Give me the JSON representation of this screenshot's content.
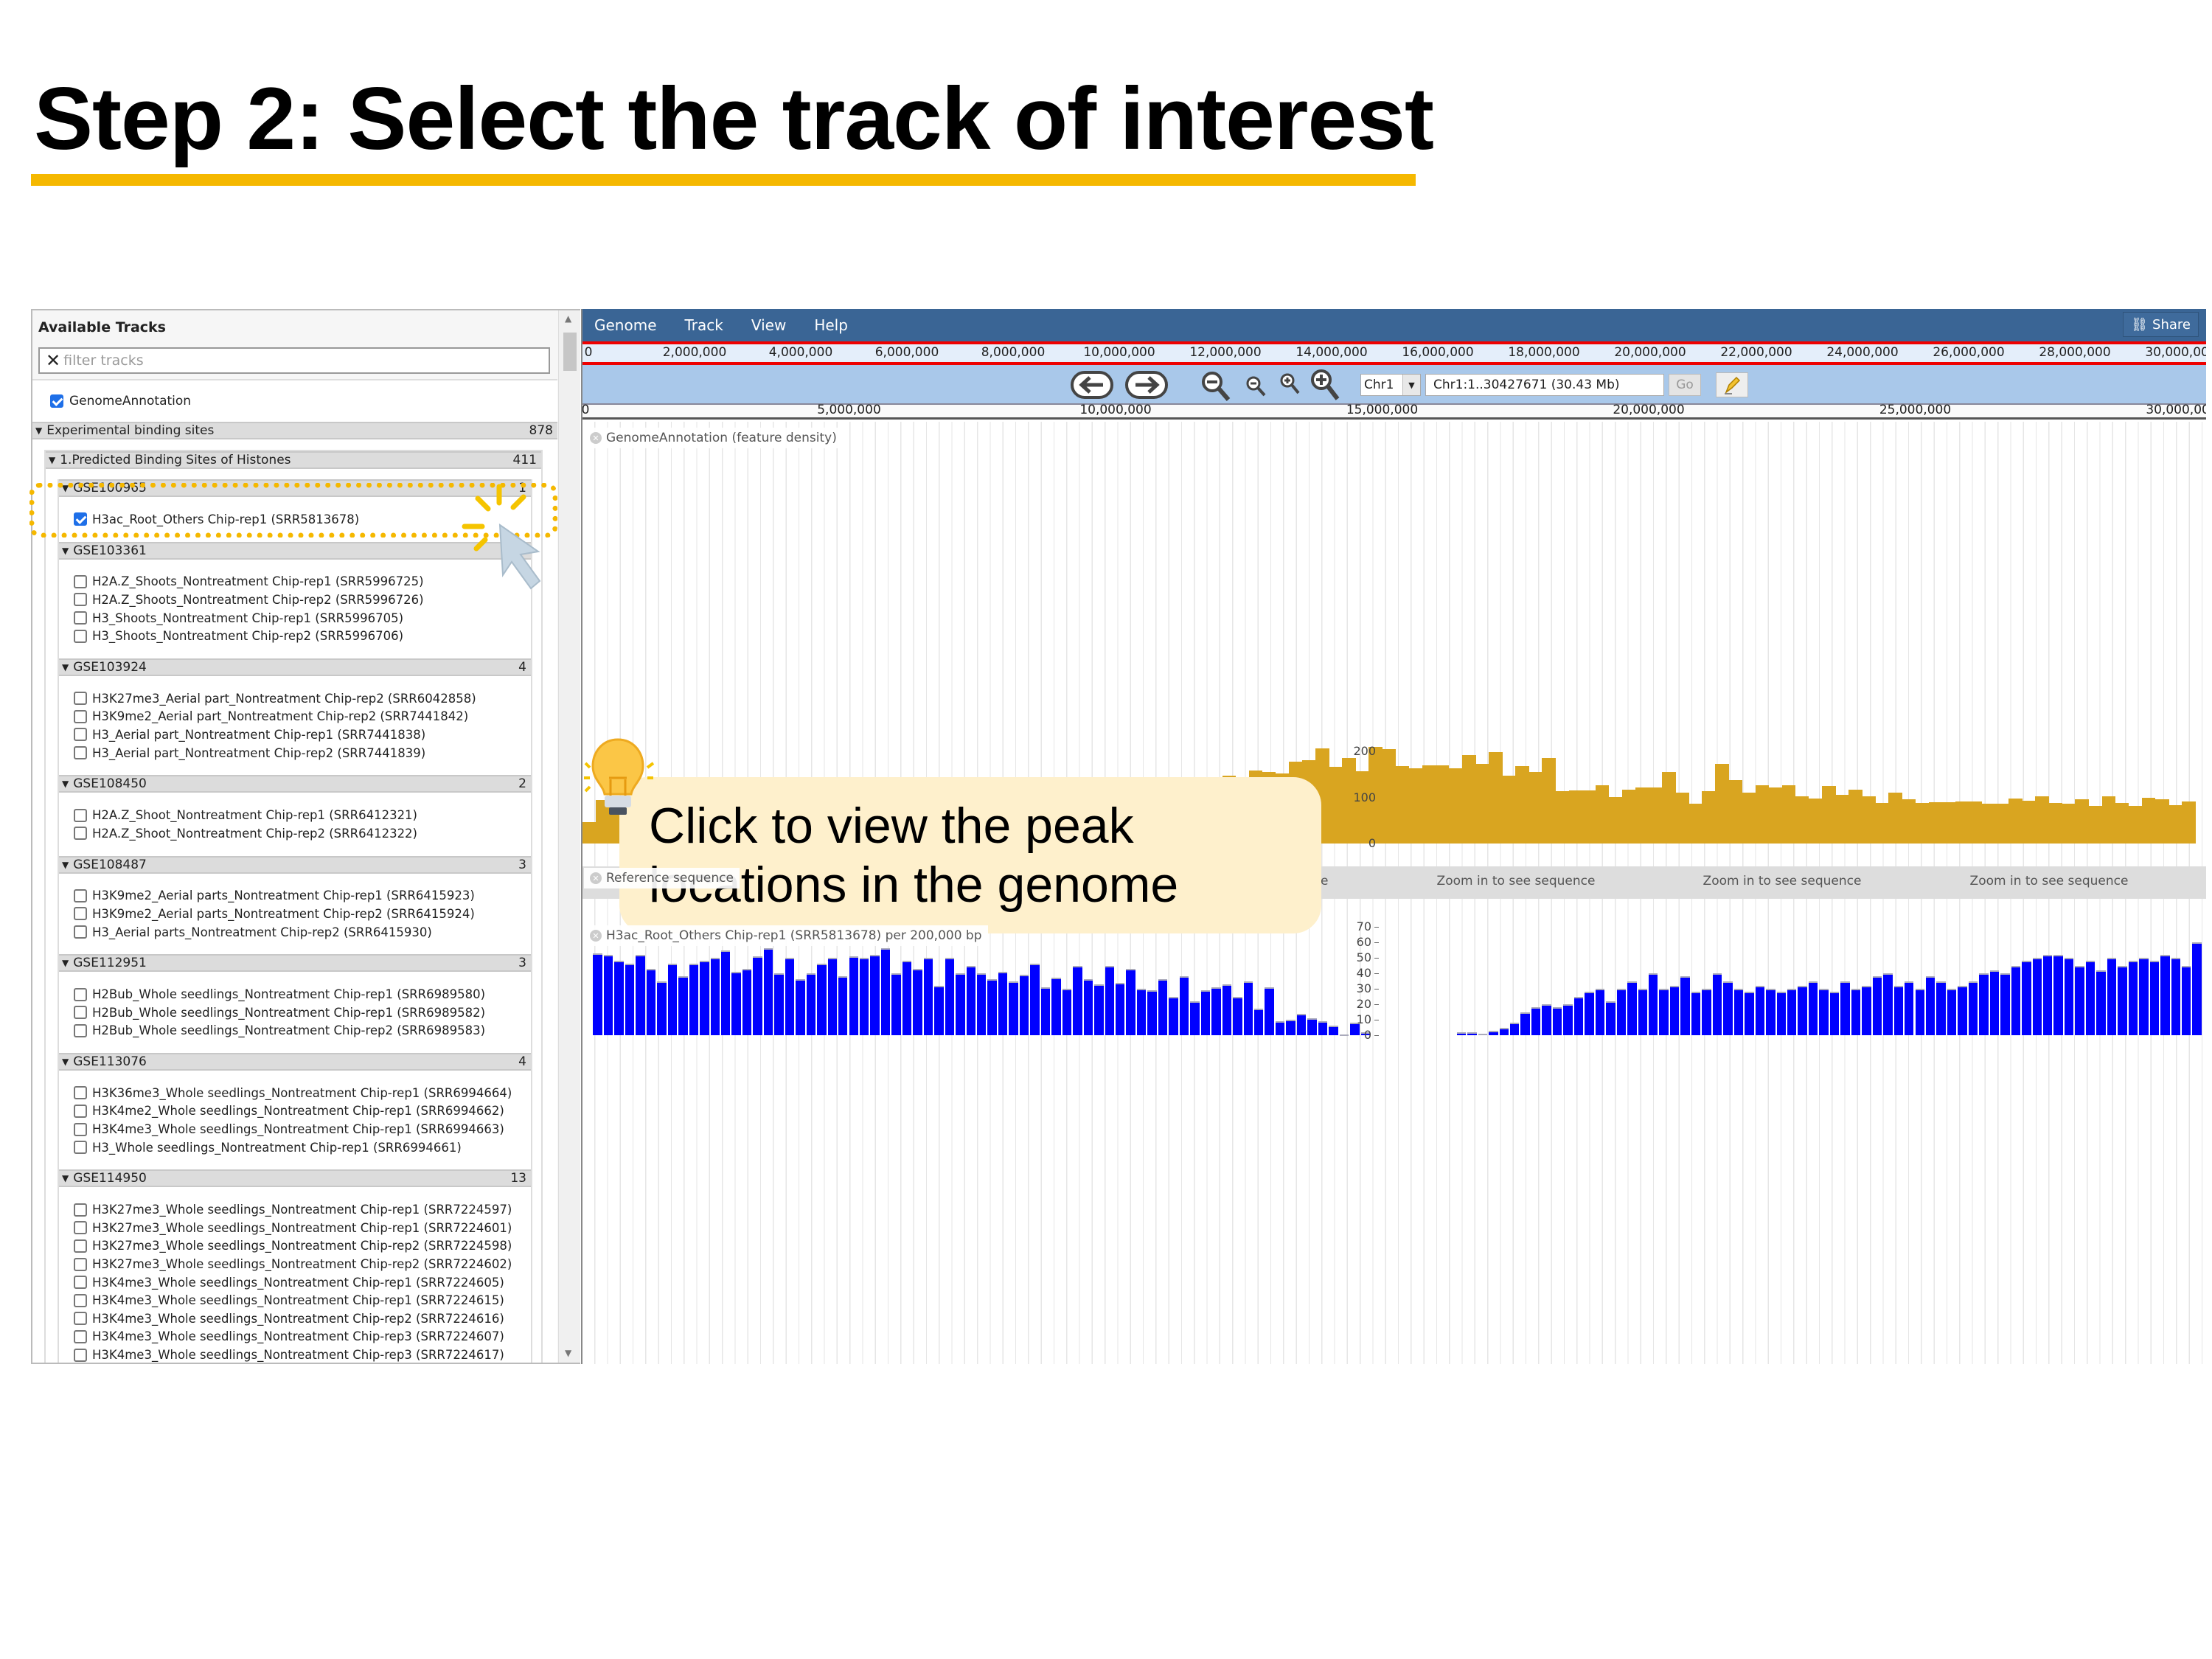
{
  "slide": {
    "title": "Step 2: Select the track of interest"
  },
  "callout": {
    "line1": "Click to view the peak",
    "line2": "locations in the genome",
    "icon": "lightbulb-icon"
  },
  "colors": {
    "accent": "#f5b800",
    "menubar": "#3a6595",
    "density": "#d9a520",
    "signal": "#0000ff",
    "callout_bg": "#fef0cc"
  },
  "sidebar": {
    "title": "Available Tracks",
    "filter_placeholder": "filter tracks",
    "genome_annotation": {
      "label": "GenomeAnnotation",
      "checked": true
    },
    "category": {
      "label": "Experimental binding sites",
      "count": "878"
    },
    "subcategory": {
      "label": "1.Predicted Binding Sites of Histones",
      "count": "411"
    },
    "groups": [
      {
        "id": "GSE100965",
        "count": "1",
        "items": [
          {
            "label": "H3ac_Root_Others Chip-rep1 (SRR5813678)",
            "checked": true
          }
        ]
      },
      {
        "id": "GSE103361",
        "count": "",
        "items": [
          {
            "label": "H2A.Z_Shoots_Nontreatment Chip-rep1 (SRR5996725)",
            "checked": false
          },
          {
            "label": "H2A.Z_Shoots_Nontreatment Chip-rep2 (SRR5996726)",
            "checked": false
          },
          {
            "label": "H3_Shoots_Nontreatment Chip-rep1 (SRR5996705)",
            "checked": false
          },
          {
            "label": "H3_Shoots_Nontreatment Chip-rep2 (SRR5996706)",
            "checked": false
          }
        ]
      },
      {
        "id": "GSE103924",
        "count": "4",
        "items": [
          {
            "label": "H3K27me3_Aerial part_Nontreatment Chip-rep2 (SRR6042858)",
            "checked": false
          },
          {
            "label": "H3K9me2_Aerial part_Nontreatment Chip-rep2 (SRR7441842)",
            "checked": false
          },
          {
            "label": "H3_Aerial part_Nontreatment Chip-rep1 (SRR7441838)",
            "checked": false
          },
          {
            "label": "H3_Aerial part_Nontreatment Chip-rep2 (SRR7441839)",
            "checked": false
          }
        ]
      },
      {
        "id": "GSE108450",
        "count": "2",
        "items": [
          {
            "label": "H2A.Z_Shoot_Nontreatment Chip-rep1 (SRR6412321)",
            "checked": false
          },
          {
            "label": "H2A.Z_Shoot_Nontreatment Chip-rep2 (SRR6412322)",
            "checked": false
          }
        ]
      },
      {
        "id": "GSE108487",
        "count": "3",
        "items": [
          {
            "label": "H3K9me2_Aerial parts_Nontreatment Chip-rep1 (SRR6415923)",
            "checked": false
          },
          {
            "label": "H3K9me2_Aerial parts_Nontreatment Chip-rep2 (SRR6415924)",
            "checked": false
          },
          {
            "label": "H3_Aerial parts_Nontreatment Chip-rep2 (SRR6415930)",
            "checked": false
          }
        ]
      },
      {
        "id": "GSE112951",
        "count": "3",
        "items": [
          {
            "label": "H2Bub_Whole seedlings_Nontreatment Chip-rep1 (SRR6989580)",
            "checked": false
          },
          {
            "label": "H2Bub_Whole seedlings_Nontreatment Chip-rep1 (SRR6989582)",
            "checked": false
          },
          {
            "label": "H2Bub_Whole seedlings_Nontreatment Chip-rep2 (SRR6989583)",
            "checked": false
          }
        ]
      },
      {
        "id": "GSE113076",
        "count": "4",
        "items": [
          {
            "label": "H3K36me3_Whole seedlings_Nontreatment Chip-rep1 (SRR6994664)",
            "checked": false
          },
          {
            "label": "H3K4me2_Whole seedlings_Nontreatment Chip-rep1 (SRR6994662)",
            "checked": false
          },
          {
            "label": "H3K4me3_Whole seedlings_Nontreatment Chip-rep1 (SRR6994663)",
            "checked": false
          },
          {
            "label": "H3_Whole seedlings_Nontreatment Chip-rep1 (SRR6994661)",
            "checked": false
          }
        ]
      },
      {
        "id": "GSE114950",
        "count": "13",
        "items": [
          {
            "label": "H3K27me3_Whole seedlings_Nontreatment Chip-rep1 (SRR7224597)",
            "checked": false
          },
          {
            "label": "H3K27me3_Whole seedlings_Nontreatment Chip-rep1 (SRR7224601)",
            "checked": false
          },
          {
            "label": "H3K27me3_Whole seedlings_Nontreatment Chip-rep2 (SRR7224598)",
            "checked": false
          },
          {
            "label": "H3K27me3_Whole seedlings_Nontreatment Chip-rep2 (SRR7224602)",
            "checked": false
          },
          {
            "label": "H3K4me3_Whole seedlings_Nontreatment Chip-rep1 (SRR7224605)",
            "checked": false
          },
          {
            "label": "H3K4me3_Whole seedlings_Nontreatment Chip-rep1 (SRR7224615)",
            "checked": false
          },
          {
            "label": "H3K4me3_Whole seedlings_Nontreatment Chip-rep2 (SRR7224616)",
            "checked": false
          },
          {
            "label": "H3K4me3_Whole seedlings_Nontreatment Chip-rep3 (SRR7224607)",
            "checked": false
          },
          {
            "label": "H3K4me3_Whole seedlings_Nontreatment Chip-rep3 (SRR7224617)",
            "checked": false
          }
        ]
      }
    ]
  },
  "browser": {
    "menu": [
      "Genome",
      "Track",
      "View",
      "Help"
    ],
    "share_label": "Share",
    "overview_ticks": [
      "0",
      "2,000,000",
      "4,000,000",
      "6,000,000",
      "8,000,000",
      "10,000,000",
      "12,000,000",
      "14,000,000",
      "16,000,000",
      "18,000,000",
      "20,000,000",
      "22,000,000",
      "24,000,000",
      "26,000,000",
      "28,000,000",
      "30,000,000"
    ],
    "detail_ticks": [
      "0",
      "5,000,000",
      "10,000,000",
      "15,000,000",
      "20,000,000",
      "25,000,000",
      "30,000,000"
    ],
    "chrom": "Chr1",
    "location": "Chr1:1..30427671 (30.43 Mb)",
    "go_label": "Go",
    "tracks": {
      "density": {
        "label": "GenomeAnnotation (feature density)",
        "axis": [
          "200",
          "100",
          "0"
        ],
        "bin_mb": 0.25,
        "values": [
          46,
          95,
          100,
          112,
          100,
          86,
          90,
          94,
          88,
          90,
          94,
          107,
          94,
          76,
          73,
          82,
          88,
          90,
          88,
          104,
          84,
          93,
          99,
          100,
          99,
          77,
          120,
          98,
          104,
          84,
          108,
          101,
          90,
          76,
          104,
          95,
          108,
          108,
          108,
          116,
          134,
          130,
          108,
          111,
          77,
          143,
          134,
          125,
          148,
          135,
          159,
          156,
          152,
          177,
          181,
          207,
          166,
          185,
          157,
          210,
          205,
          168,
          163,
          169,
          170,
          164,
          192,
          173,
          198,
          147,
          168,
          156,
          186,
          113,
          115,
          116,
          126,
          101,
          117,
          122,
          121,
          155,
          111,
          87,
          113,
          173,
          137,
          111,
          127,
          121,
          126,
          103,
          97,
          125,
          105,
          117,
          103,
          88,
          111,
          96,
          88,
          89,
          89,
          92,
          91,
          87,
          86,
          97,
          93,
          102,
          88,
          86,
          96,
          82,
          103,
          88,
          82,
          99,
          96,
          83,
          91
        ]
      },
      "reference": {
        "label": "Reference sequence",
        "hint": "Zoom in to see sequence"
      },
      "signal": {
        "label": "H3ac_Root_Others Chip-rep1 (SRR5813678) per 200,000 bp",
        "axis": [
          "70",
          "60",
          "50",
          "40",
          "30",
          "20",
          "10",
          "0"
        ],
        "bin_mb": 0.2,
        "values": [
          0,
          53,
          52,
          48,
          46,
          52,
          43,
          35,
          46,
          38,
          46,
          48,
          50,
          55,
          41,
          43,
          51,
          56,
          40,
          50,
          36,
          40,
          46,
          50,
          38,
          51,
          50,
          52,
          56,
          40,
          48,
          43,
          50,
          32,
          50,
          40,
          45,
          40,
          36,
          41,
          35,
          39,
          46,
          31,
          37,
          30,
          45,
          36,
          33,
          45,
          34,
          43,
          30,
          29,
          36,
          25,
          38,
          22,
          29,
          31,
          33,
          25,
          35,
          17,
          31,
          9,
          10,
          14,
          11,
          9,
          6,
          0.3,
          8,
          2,
          0,
          0,
          0,
          0,
          0,
          0,
          0,
          0,
          2,
          2,
          1,
          3,
          5,
          8,
          15,
          18,
          20,
          18,
          20,
          25,
          28,
          30,
          22,
          30,
          35,
          30,
          40,
          30,
          32,
          38,
          28,
          30,
          40,
          35,
          30,
          28,
          32,
          30,
          28,
          30,
          32,
          35,
          30,
          28,
          35,
          30,
          32,
          38,
          40,
          32,
          35,
          30,
          38,
          35,
          30,
          32,
          35,
          40,
          42,
          40,
          45,
          48,
          50,
          52,
          52,
          50,
          45,
          48,
          42,
          50,
          45,
          48,
          50,
          48,
          52,
          50,
          45,
          60
        ]
      }
    }
  }
}
